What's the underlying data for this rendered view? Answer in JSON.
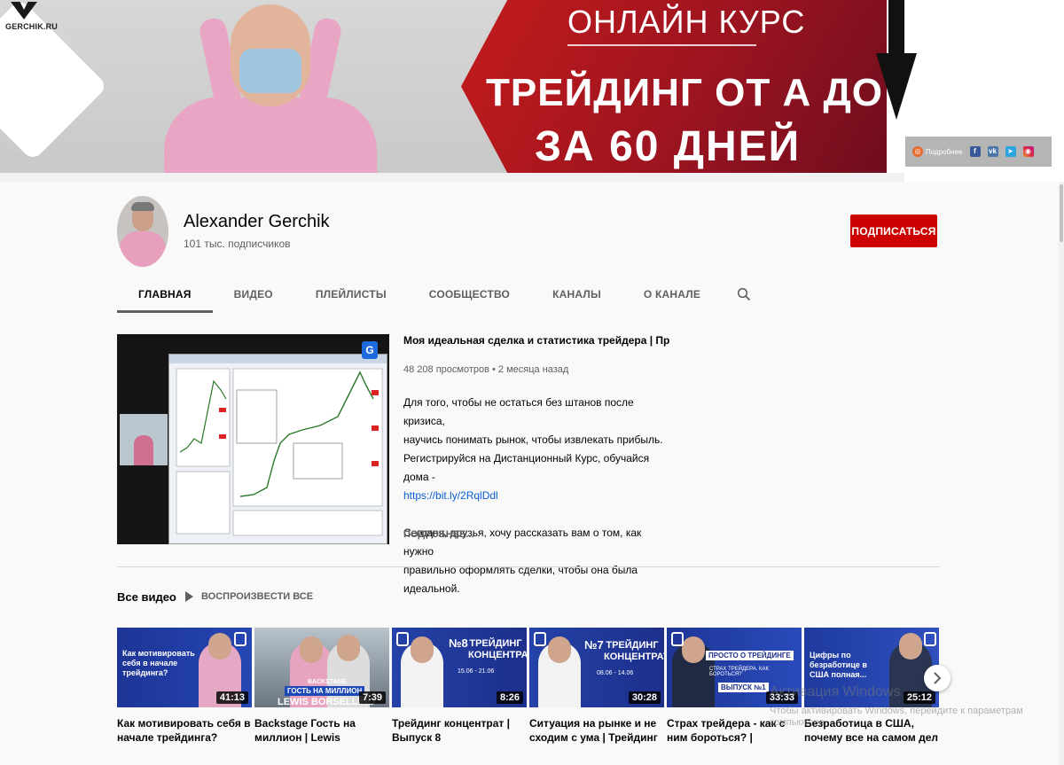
{
  "banner": {
    "logo_text": "GERCHIK.RU",
    "title": "ОНЛАЙН КУРС",
    "line2": "ТРЕЙДИНГ ОТ А ДО Я",
    "line3": "ЗА 60 ДНЕЙ",
    "links": {
      "more_label": "Подробнее",
      "icons": [
        "facebook-icon",
        "vk-icon",
        "telegram-icon",
        "instagram-icon"
      ]
    }
  },
  "channel": {
    "name": "Alexander Gerchik",
    "subscribers": "101 тыс. подписчиков",
    "subscribe_label": "ПОДПИСАТЬСЯ"
  },
  "tabs": [
    {
      "label": "ГЛАВНАЯ",
      "active": true
    },
    {
      "label": "ВИДЕО",
      "active": false
    },
    {
      "label": "ПЛЕЙЛИСТЫ",
      "active": false
    },
    {
      "label": "СООБЩЕСТВО",
      "active": false
    },
    {
      "label": "КАНАЛЫ",
      "active": false
    },
    {
      "label": "О КАНАЛЕ",
      "active": false
    }
  ],
  "featured": {
    "title": "Моя идеальная сделка и статистика трейдера | Прямой э...",
    "meta": "48 208 просмотров • 2 месяца назад",
    "desc_lines": [
      "Для того, чтобы не остаться без штанов после кризиса,",
      "научись понимать рынок, чтобы извлекать прибыль.",
      "Регистрируйся на Дистанционный Курс, обучайся дома -"
    ],
    "link": "https://bit.ly/2RqlDdl",
    "desc_lines2": [
      "Сегодня, друзья, хочу рассказать вам о том, как нужно",
      "правильно оформлять сделки, чтобы она была идеальной."
    ],
    "more_label": "ПОДРОБНЕЕ..."
  },
  "section": {
    "title": "Все видео",
    "play_all": "ВОСПРОИЗВЕСТИ ВСЕ"
  },
  "videos": [
    {
      "title": "Как мотивировать себя в начале трейдинга?",
      "duration": "41:13",
      "thumb_text": "Как мотивировать себя в начале трейдинга?"
    },
    {
      "title": "Backstage Гость на миллион | Lewis Borsellino",
      "duration": "7:39",
      "thumb_text": "ГОСТЬ НА МИЛЛИОН",
      "thumb_text2": "LEWIS BORSELLINO",
      "thumb_text3": "BACKSTAGE"
    },
    {
      "title": "Трейдинг концентрат | Выпуск 8",
      "duration": "8:26",
      "thumb_text": "ТРЕЙДИНГ КОНЦЕНТРАТ",
      "thumb_num": "№8",
      "thumb_dates": "15.06 - 21.06"
    },
    {
      "title": "Ситуация на рынке и не сходим с ума | Трейдинг",
      "duration": "30:28",
      "thumb_text": "ТРЕЙДИНГ КОНЦЕНТРАТ",
      "thumb_num": "№7",
      "thumb_dates": "08.06 - 14.06"
    },
    {
      "title": "Страх трейдера - как с ним бороться? | Александ",
      "duration": "33:33",
      "thumb_text": "ПРОСТО О ТРЕЙДИНГЕ",
      "thumb_text2": "СТРАХ ТРЕЙДЕРА. КАК БОРОТЬСЯ?",
      "thumb_text3": "ВЫПУСК №1"
    },
    {
      "title": "Безработица в США, почему все на самом дел",
      "duration": "25:12",
      "thumb_text": "Цифры по безработице в США полная..."
    }
  ],
  "watermark": {
    "line1": "Активация Windows",
    "line2": "Чтобы активировать Windows, перейдите к параметрам компьютера."
  },
  "colors": {
    "accent": "#cc0000",
    "link": "#065fd4",
    "thumb_blue": "#1b2d8f"
  }
}
